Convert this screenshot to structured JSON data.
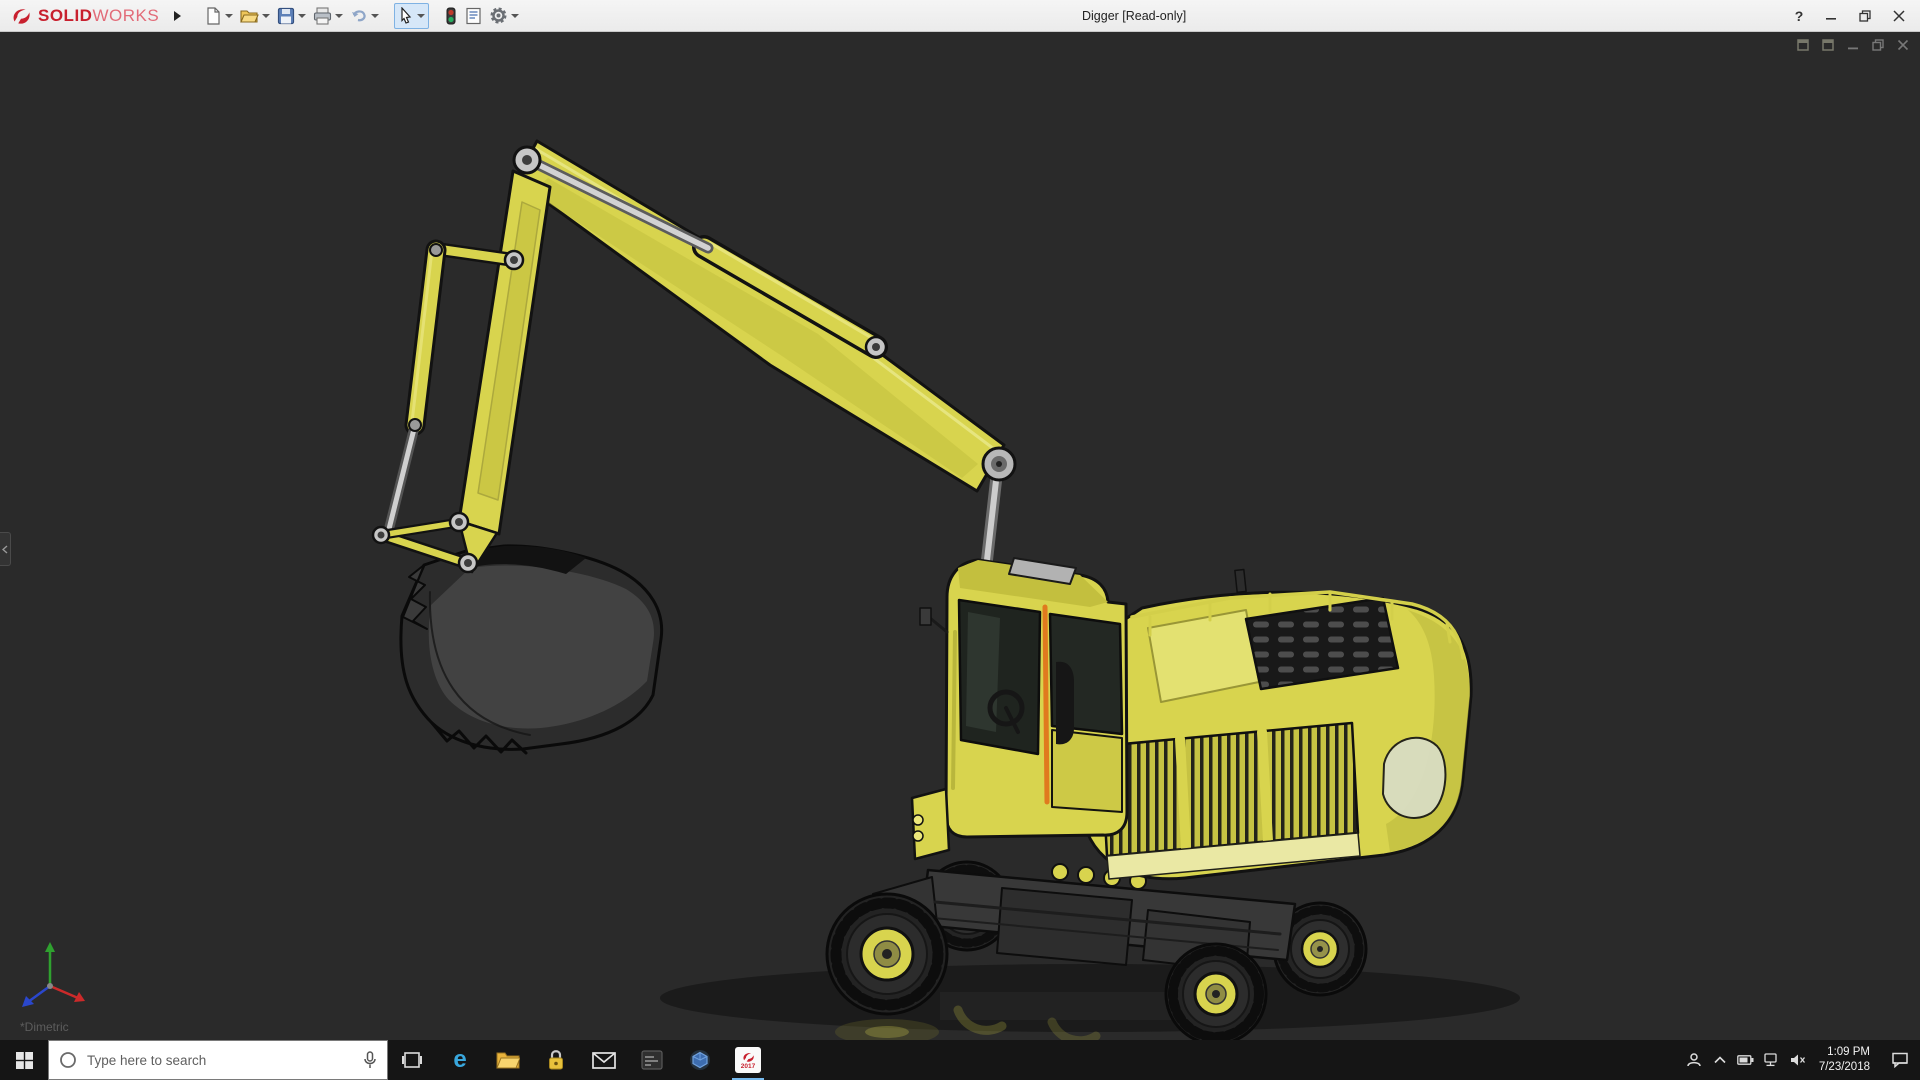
{
  "titlebar": {
    "brand_bold": "SOLID",
    "brand_light": "WORKS",
    "title": "Digger [Read-only]",
    "help_label": "?"
  },
  "toolbar_icons": [
    "new-document",
    "open",
    "save",
    "print",
    "undo",
    "select",
    "rebuild",
    "file-properties",
    "options"
  ],
  "viewport": {
    "view_label": "*Dimetric",
    "background": "#2a2a2a"
  },
  "icons": {
    "edge_glyph": "e"
  },
  "taskbar": {
    "search_placeholder": "Type here to search",
    "solidworks_year": "2017",
    "clock_time": "1:09 PM",
    "clock_date": "7/23/2018"
  },
  "colors": {
    "excavator_yellow": "#d8d44e",
    "excavator_shade": "#b9b63c",
    "door_stripe_orange": "#e07a1e",
    "brand_red": "#c8202e",
    "titlebar_bg": "#f0f0f0",
    "taskbar_bg": "#151515",
    "viewport_bg": "#2a2a2a"
  }
}
